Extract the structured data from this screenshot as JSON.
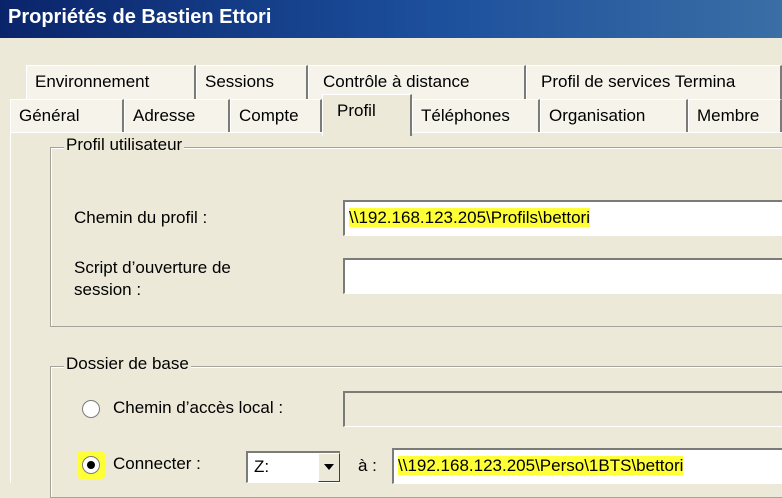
{
  "window": {
    "title": "Propriétés de Bastien Ettori"
  },
  "tabs": {
    "row1": [
      "Environnement",
      "Sessions",
      "Contrôle à distance",
      "Profil de services Termina"
    ],
    "row2": [
      "Général",
      "Adresse",
      "Compte",
      "Profil",
      "Téléphones",
      "Organisation",
      "Membre"
    ],
    "active": "Profil"
  },
  "profile_group": {
    "legend": "Profil utilisateur",
    "profile_path_label": "Chemin du profil :",
    "profile_path_value": "\\\\192.168.123.205\\Profils\\bettori",
    "logon_script_label_line1": "Script d’ouverture de",
    "logon_script_label_line2": "session :",
    "logon_script_value": ""
  },
  "home_group": {
    "legend": "Dossier de base",
    "local_path_label": "Chemin d’accès local :",
    "local_path_value": "",
    "connect_label": "Connecter :",
    "drive_value": "Z:",
    "to_label": "à :",
    "connect_path_value": "\\\\192.168.123.205\\Perso\\1BTS\\bettori",
    "selected_option": "Connecter"
  },
  "colors": {
    "highlight": "#ffff38",
    "title_bar": "#0a246a",
    "dialog_bg": "#ece9d8"
  }
}
